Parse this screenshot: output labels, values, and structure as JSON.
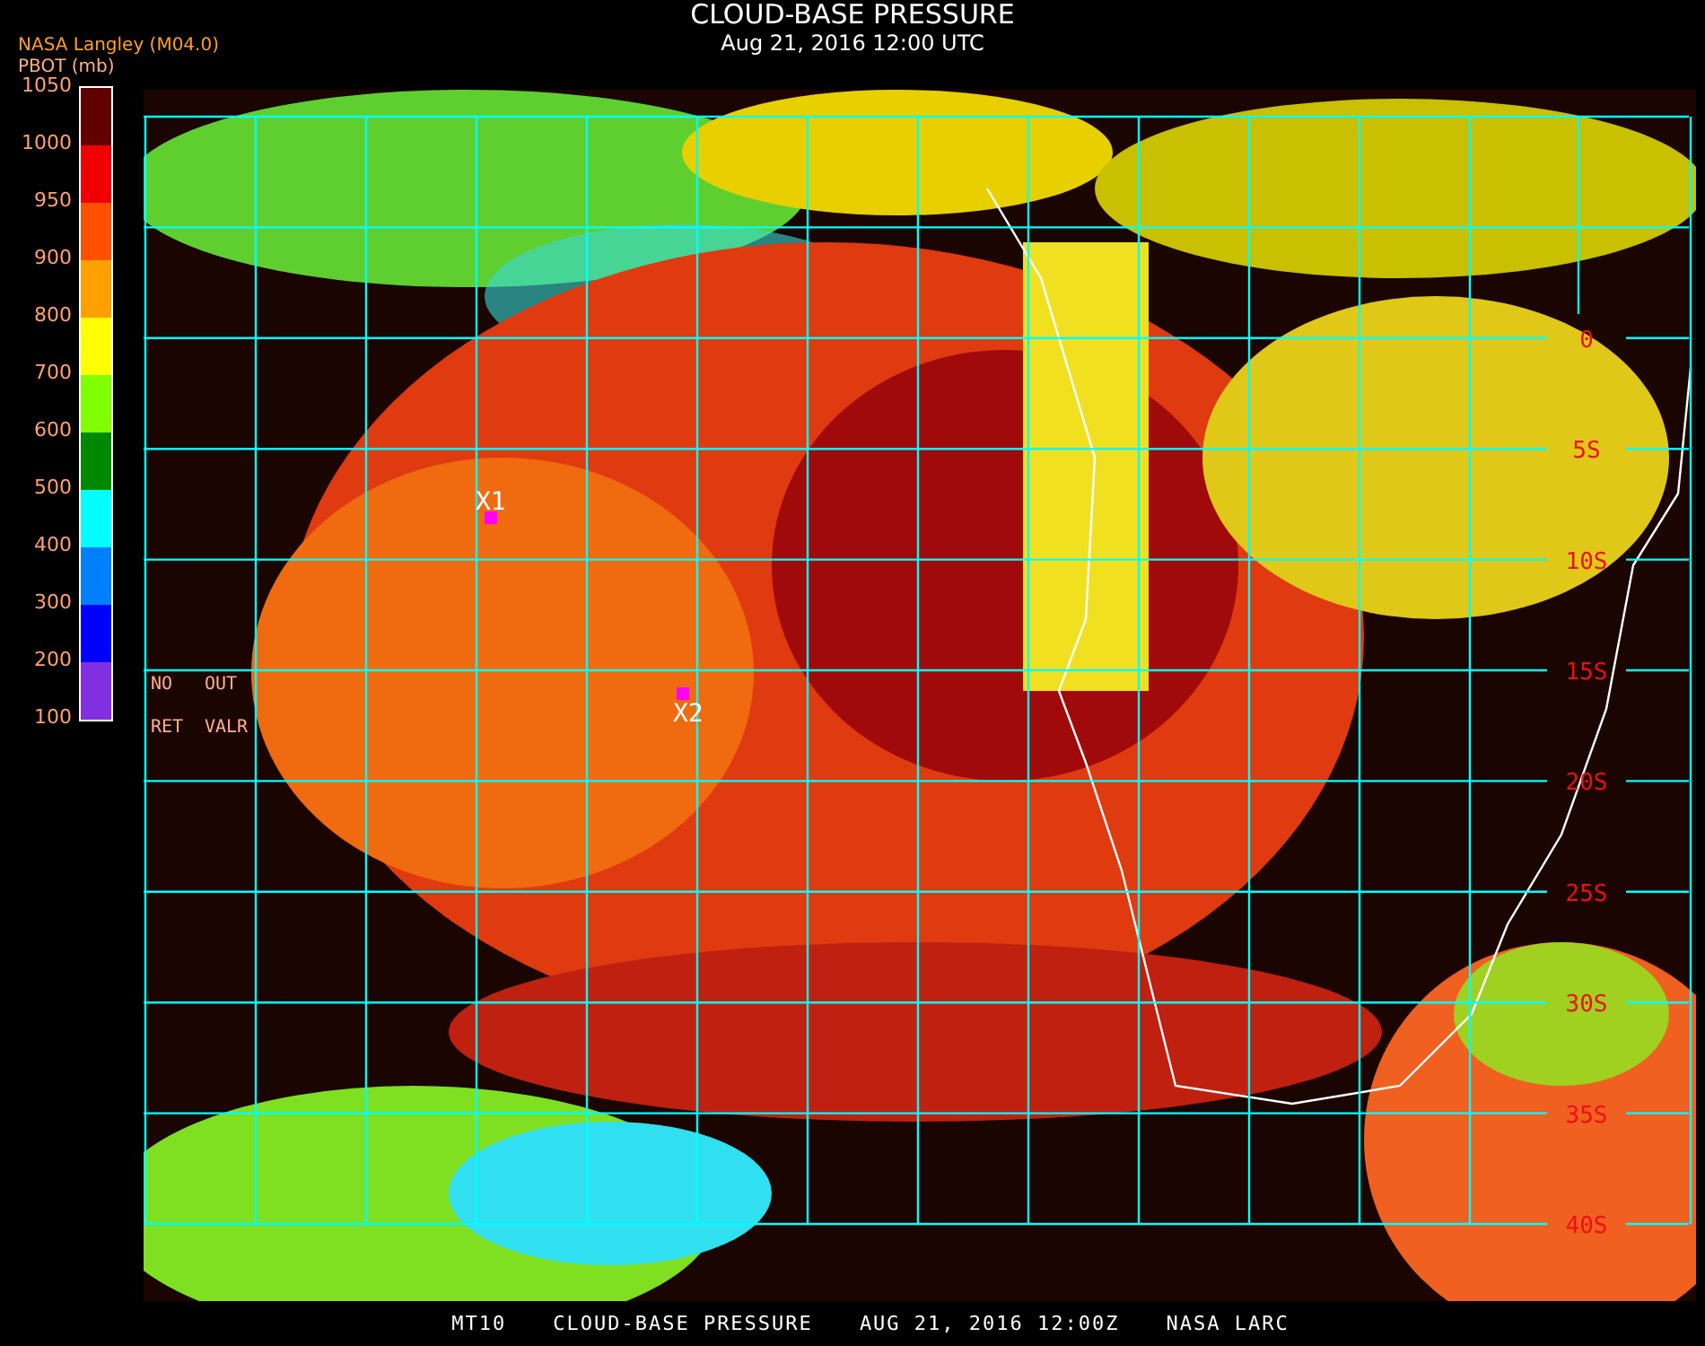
{
  "header": {
    "source": "NASA Langley (M04.0)",
    "title": "CLOUD-BASE PRESSURE",
    "datetime": "Aug 21, 2016 12:00 UTC"
  },
  "legend": {
    "title": "PBOT (mb)",
    "labels": [
      "1050",
      "1000",
      "950",
      "900",
      "800",
      "700",
      "600",
      "500",
      "400",
      "300",
      "200",
      "100"
    ],
    "segments": [
      {
        "color": "#600000"
      },
      {
        "color": "#f00000"
      },
      {
        "color": "#ff5000"
      },
      {
        "color": "#ffa000"
      },
      {
        "color": "#ffff00"
      },
      {
        "color": "#80ff00"
      },
      {
        "color": "#008800"
      },
      {
        "color": "#00ffff"
      },
      {
        "color": "#0080ff"
      },
      {
        "color": "#0000ff"
      },
      {
        "color": "#8030e0"
      }
    ]
  },
  "map": {
    "no_data_key": [
      [
        "NO",
        "OUT"
      ],
      [
        "RET",
        "VALR"
      ]
    ],
    "latitude_labels": [
      "0",
      "5S",
      "10S",
      "15S",
      "20S",
      "25S",
      "30S",
      "35S",
      "40S"
    ],
    "markers": [
      {
        "label": "X1"
      },
      {
        "label": "X2"
      }
    ]
  },
  "footer": {
    "caption": [
      "MT10",
      "CLOUD-BASE PRESSURE",
      "AUG 21, 2016 12:00Z",
      "NASA LARC"
    ]
  }
}
